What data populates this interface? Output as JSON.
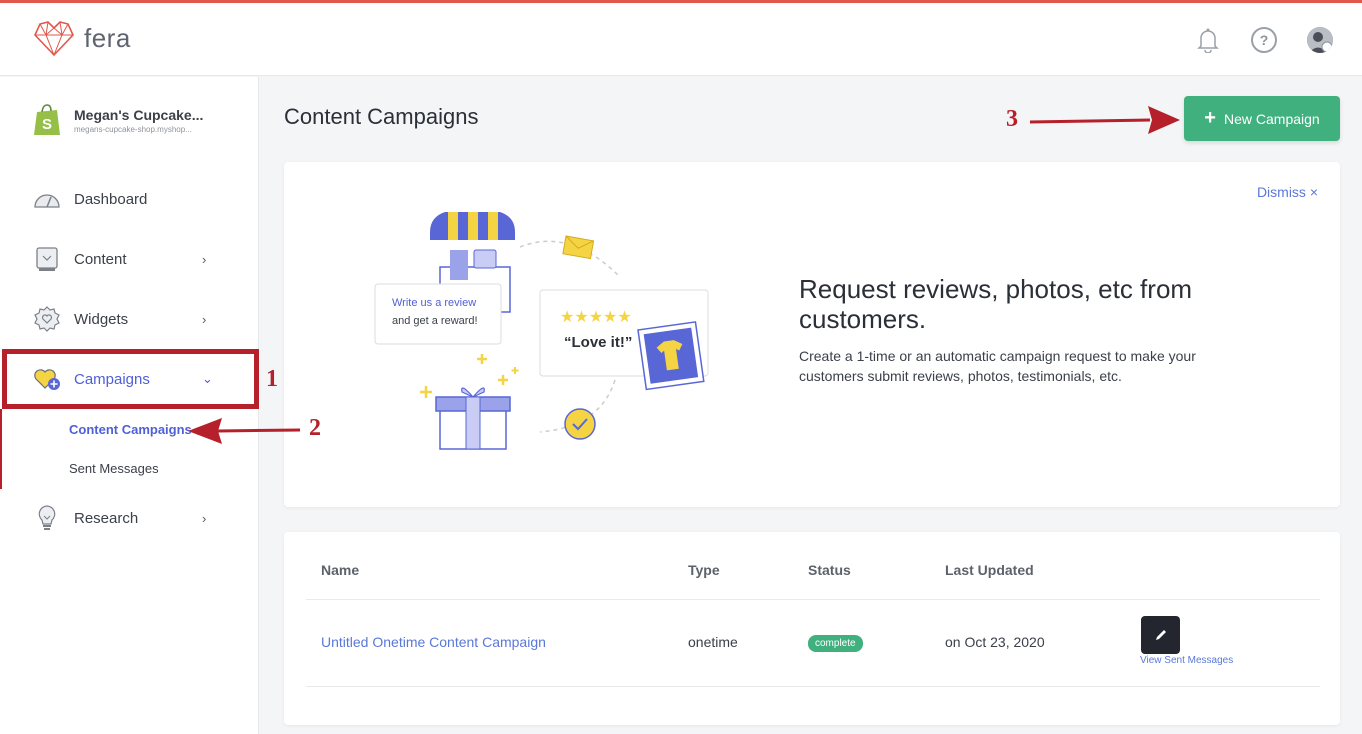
{
  "app": {
    "brand": "fera"
  },
  "header": {
    "icons": [
      "bell-icon",
      "help-icon",
      "avatar-settings-icon"
    ],
    "help_glyph": "?"
  },
  "sidebar": {
    "shop_name": "Megan's Cupcake...",
    "shop_url": "megans-cupcake-shop.myshop...",
    "items": [
      {
        "label": "Dashboard",
        "icon": "gauge-icon"
      },
      {
        "label": "Content",
        "icon": "photo-icon",
        "chevron": "›"
      },
      {
        "label": "Widgets",
        "icon": "badge-heart-icon",
        "chevron": "›"
      },
      {
        "label": "Campaigns",
        "icon": "heart-plus-icon",
        "chevron": "⌄"
      },
      {
        "label": "Research",
        "icon": "lightbulb-icon",
        "chevron": "›"
      }
    ],
    "sub_items": [
      {
        "label": "Content Campaigns"
      },
      {
        "label": "Sent Messages"
      }
    ]
  },
  "main": {
    "title": "Content Campaigns",
    "new_campaign_label": "New Campaign",
    "new_campaign_plus": "+"
  },
  "hero": {
    "dismiss": "Dismiss ×",
    "title": "Request reviews, photos, etc from customers.",
    "subtitle": "Create a 1-time or an automatic campaign request to make your customers submit reviews, photos, testimonials, etc.",
    "bubble_line1": "Write us a review",
    "bubble_line2": "and get a reward!",
    "review_quote": "“Love it!”"
  },
  "table": {
    "headers": [
      "Name",
      "Type",
      "Status",
      "Last Updated"
    ],
    "rows": [
      {
        "name": "Untitled Onetime Content Campaign",
        "type": "onetime",
        "status": "complete",
        "updated": "on Oct 23, 2020",
        "action": "View Sent Messages"
      }
    ]
  },
  "annotations": [
    "1",
    "2",
    "3"
  ],
  "colors": {
    "accent": "#4f5fd6",
    "primary_button": "#40b07e",
    "annotation": "#b5202a",
    "top_line": "#e2574c"
  }
}
